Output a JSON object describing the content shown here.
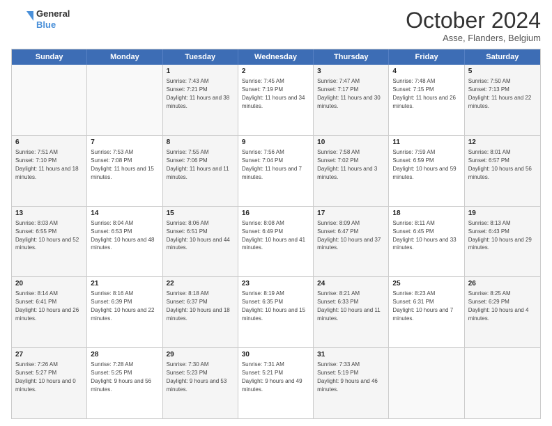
{
  "header": {
    "logo_line1": "General",
    "logo_line2": "Blue",
    "month_title": "October 2024",
    "subtitle": "Asse, Flanders, Belgium"
  },
  "days_of_week": [
    "Sunday",
    "Monday",
    "Tuesday",
    "Wednesday",
    "Thursday",
    "Friday",
    "Saturday"
  ],
  "weeks": [
    [
      {
        "day": "",
        "sunrise": "",
        "sunset": "",
        "daylight": "",
        "empty": true
      },
      {
        "day": "",
        "sunrise": "",
        "sunset": "",
        "daylight": "",
        "empty": true
      },
      {
        "day": "1",
        "sunrise": "Sunrise: 7:43 AM",
        "sunset": "Sunset: 7:21 PM",
        "daylight": "Daylight: 11 hours and 38 minutes."
      },
      {
        "day": "2",
        "sunrise": "Sunrise: 7:45 AM",
        "sunset": "Sunset: 7:19 PM",
        "daylight": "Daylight: 11 hours and 34 minutes."
      },
      {
        "day": "3",
        "sunrise": "Sunrise: 7:47 AM",
        "sunset": "Sunset: 7:17 PM",
        "daylight": "Daylight: 11 hours and 30 minutes."
      },
      {
        "day": "4",
        "sunrise": "Sunrise: 7:48 AM",
        "sunset": "Sunset: 7:15 PM",
        "daylight": "Daylight: 11 hours and 26 minutes."
      },
      {
        "day": "5",
        "sunrise": "Sunrise: 7:50 AM",
        "sunset": "Sunset: 7:13 PM",
        "daylight": "Daylight: 11 hours and 22 minutes."
      }
    ],
    [
      {
        "day": "6",
        "sunrise": "Sunrise: 7:51 AM",
        "sunset": "Sunset: 7:10 PM",
        "daylight": "Daylight: 11 hours and 18 minutes."
      },
      {
        "day": "7",
        "sunrise": "Sunrise: 7:53 AM",
        "sunset": "Sunset: 7:08 PM",
        "daylight": "Daylight: 11 hours and 15 minutes."
      },
      {
        "day": "8",
        "sunrise": "Sunrise: 7:55 AM",
        "sunset": "Sunset: 7:06 PM",
        "daylight": "Daylight: 11 hours and 11 minutes."
      },
      {
        "day": "9",
        "sunrise": "Sunrise: 7:56 AM",
        "sunset": "Sunset: 7:04 PM",
        "daylight": "Daylight: 11 hours and 7 minutes."
      },
      {
        "day": "10",
        "sunrise": "Sunrise: 7:58 AM",
        "sunset": "Sunset: 7:02 PM",
        "daylight": "Daylight: 11 hours and 3 minutes."
      },
      {
        "day": "11",
        "sunrise": "Sunrise: 7:59 AM",
        "sunset": "Sunset: 6:59 PM",
        "daylight": "Daylight: 10 hours and 59 minutes."
      },
      {
        "day": "12",
        "sunrise": "Sunrise: 8:01 AM",
        "sunset": "Sunset: 6:57 PM",
        "daylight": "Daylight: 10 hours and 56 minutes."
      }
    ],
    [
      {
        "day": "13",
        "sunrise": "Sunrise: 8:03 AM",
        "sunset": "Sunset: 6:55 PM",
        "daylight": "Daylight: 10 hours and 52 minutes."
      },
      {
        "day": "14",
        "sunrise": "Sunrise: 8:04 AM",
        "sunset": "Sunset: 6:53 PM",
        "daylight": "Daylight: 10 hours and 48 minutes."
      },
      {
        "day": "15",
        "sunrise": "Sunrise: 8:06 AM",
        "sunset": "Sunset: 6:51 PM",
        "daylight": "Daylight: 10 hours and 44 minutes."
      },
      {
        "day": "16",
        "sunrise": "Sunrise: 8:08 AM",
        "sunset": "Sunset: 6:49 PM",
        "daylight": "Daylight: 10 hours and 41 minutes."
      },
      {
        "day": "17",
        "sunrise": "Sunrise: 8:09 AM",
        "sunset": "Sunset: 6:47 PM",
        "daylight": "Daylight: 10 hours and 37 minutes."
      },
      {
        "day": "18",
        "sunrise": "Sunrise: 8:11 AM",
        "sunset": "Sunset: 6:45 PM",
        "daylight": "Daylight: 10 hours and 33 minutes."
      },
      {
        "day": "19",
        "sunrise": "Sunrise: 8:13 AM",
        "sunset": "Sunset: 6:43 PM",
        "daylight": "Daylight: 10 hours and 29 minutes."
      }
    ],
    [
      {
        "day": "20",
        "sunrise": "Sunrise: 8:14 AM",
        "sunset": "Sunset: 6:41 PM",
        "daylight": "Daylight: 10 hours and 26 minutes."
      },
      {
        "day": "21",
        "sunrise": "Sunrise: 8:16 AM",
        "sunset": "Sunset: 6:39 PM",
        "daylight": "Daylight: 10 hours and 22 minutes."
      },
      {
        "day": "22",
        "sunrise": "Sunrise: 8:18 AM",
        "sunset": "Sunset: 6:37 PM",
        "daylight": "Daylight: 10 hours and 18 minutes."
      },
      {
        "day": "23",
        "sunrise": "Sunrise: 8:19 AM",
        "sunset": "Sunset: 6:35 PM",
        "daylight": "Daylight: 10 hours and 15 minutes."
      },
      {
        "day": "24",
        "sunrise": "Sunrise: 8:21 AM",
        "sunset": "Sunset: 6:33 PM",
        "daylight": "Daylight: 10 hours and 11 minutes."
      },
      {
        "day": "25",
        "sunrise": "Sunrise: 8:23 AM",
        "sunset": "Sunset: 6:31 PM",
        "daylight": "Daylight: 10 hours and 7 minutes."
      },
      {
        "day": "26",
        "sunrise": "Sunrise: 8:25 AM",
        "sunset": "Sunset: 6:29 PM",
        "daylight": "Daylight: 10 hours and 4 minutes."
      }
    ],
    [
      {
        "day": "27",
        "sunrise": "Sunrise: 7:26 AM",
        "sunset": "Sunset: 5:27 PM",
        "daylight": "Daylight: 10 hours and 0 minutes."
      },
      {
        "day": "28",
        "sunrise": "Sunrise: 7:28 AM",
        "sunset": "Sunset: 5:25 PM",
        "daylight": "Daylight: 9 hours and 56 minutes."
      },
      {
        "day": "29",
        "sunrise": "Sunrise: 7:30 AM",
        "sunset": "Sunset: 5:23 PM",
        "daylight": "Daylight: 9 hours and 53 minutes."
      },
      {
        "day": "30",
        "sunrise": "Sunrise: 7:31 AM",
        "sunset": "Sunset: 5:21 PM",
        "daylight": "Daylight: 9 hours and 49 minutes."
      },
      {
        "day": "31",
        "sunrise": "Sunrise: 7:33 AM",
        "sunset": "Sunset: 5:19 PM",
        "daylight": "Daylight: 9 hours and 46 minutes."
      },
      {
        "day": "",
        "sunrise": "",
        "sunset": "",
        "daylight": "",
        "empty": true
      },
      {
        "day": "",
        "sunrise": "",
        "sunset": "",
        "daylight": "",
        "empty": true
      }
    ]
  ]
}
